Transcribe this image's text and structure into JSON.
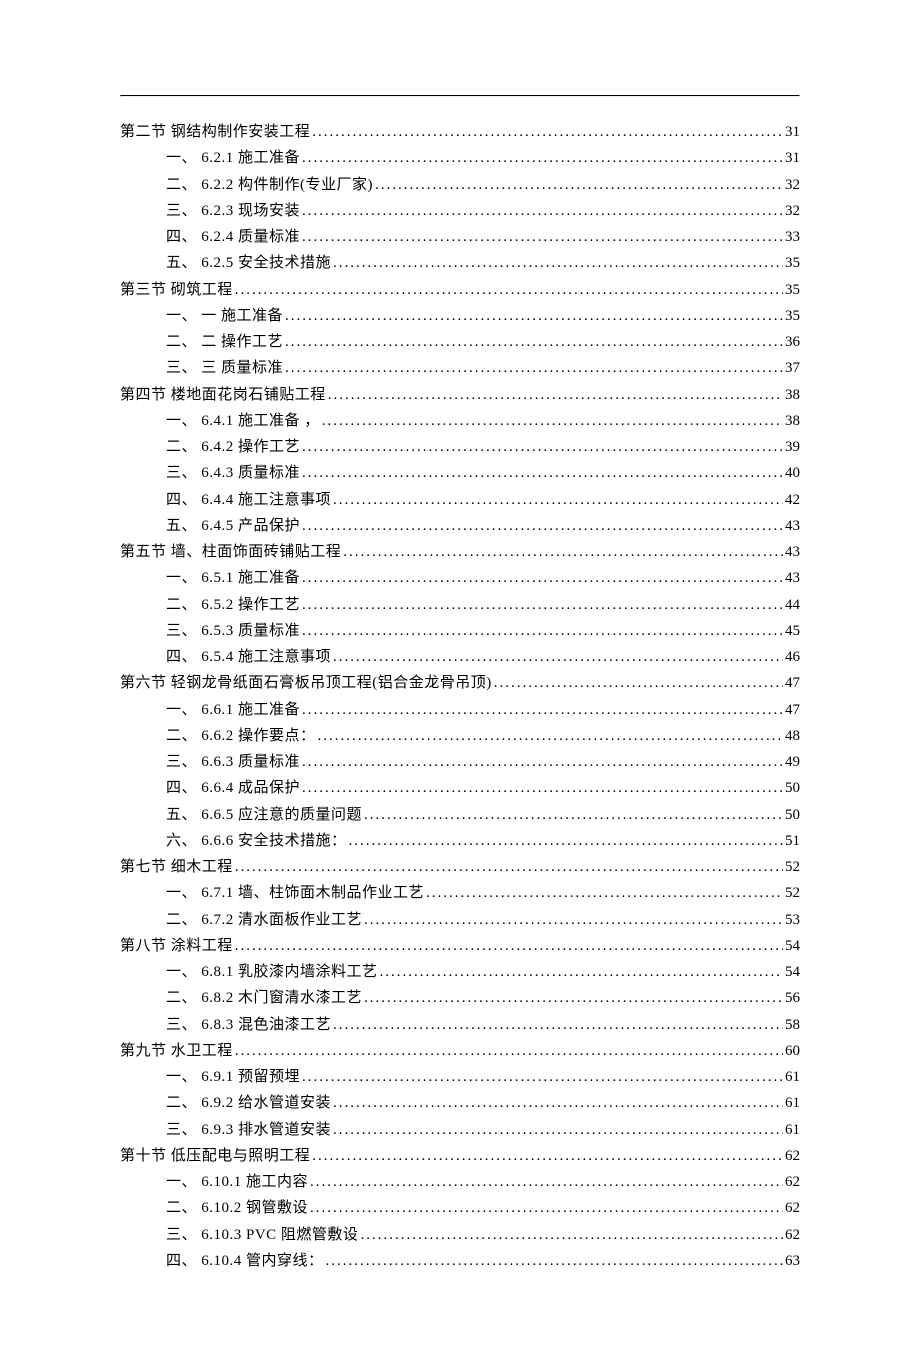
{
  "toc": [
    {
      "level": 1,
      "text": "第二节 钢结构制作安装工程",
      "page": "31"
    },
    {
      "level": 2,
      "text": "一、 6.2.1 施工准备",
      "page": "31"
    },
    {
      "level": 2,
      "text": "二、 6.2.2 构件制作(专业厂家)",
      "page": "32"
    },
    {
      "level": 2,
      "text": "三、 6.2.3  现场安装",
      "page": "32"
    },
    {
      "level": 2,
      "text": "四、 6.2.4 质量标准",
      "page": "33"
    },
    {
      "level": 2,
      "text": "五、 6.2.5  安全技术措施",
      "page": "35"
    },
    {
      "level": 1,
      "text": "第三节 砌筑工程",
      "page": "35"
    },
    {
      "level": 2,
      "text": "一、 一 施工准备",
      "page": "35"
    },
    {
      "level": 2,
      "text": "二、 二 操作工艺",
      "page": "36"
    },
    {
      "level": 2,
      "text": "三、 三 质量标准",
      "page": "37"
    },
    {
      "level": 1,
      "text": "第四节 楼地面花岗石铺贴工程",
      "page": "38"
    },
    {
      "level": 2,
      "text": "一、 6.4.1 施工准备  ，",
      "page": "38"
    },
    {
      "level": 2,
      "text": "二、 6.4.2 操作工艺",
      "page": "39"
    },
    {
      "level": 2,
      "text": "三、 6.4.3 质量标准",
      "page": "40"
    },
    {
      "level": 2,
      "text": "四、 6.4.4 施工注意事项",
      "page": "42"
    },
    {
      "level": 2,
      "text": "五、 6.4.5 产品保护",
      "page": "43"
    },
    {
      "level": 1,
      "text": "第五节 墙、柱面饰面砖铺贴工程",
      "page": "43"
    },
    {
      "level": 2,
      "text": "一、 6.5.1 施工准备",
      "page": "43"
    },
    {
      "level": 2,
      "text": "二、 6.5.2 操作工艺",
      "page": "44"
    },
    {
      "level": 2,
      "text": "三、 6.5.3 质量标准",
      "page": "45"
    },
    {
      "level": 2,
      "text": "四、 6.5.4 施工注意事项",
      "page": "46"
    },
    {
      "level": 1,
      "text": "第六节 轻钢龙骨纸面石膏板吊顶工程(铝合金龙骨吊顶)",
      "page": "47"
    },
    {
      "level": 2,
      "text": "一、 6.6.1 施工准备",
      "page": "47"
    },
    {
      "level": 2,
      "text": "二、 6.6.2 操作要点：",
      "page": "48"
    },
    {
      "level": 2,
      "text": "三、 6.6.3 质量标准",
      "page": "49"
    },
    {
      "level": 2,
      "text": "四、 6.6.4 成品保护",
      "page": "50"
    },
    {
      "level": 2,
      "text": "五、 6.6.5 应注意的质量问题",
      "page": "50"
    },
    {
      "level": 2,
      "text": "六、 6.6.6 安全技术措施：",
      "page": "51"
    },
    {
      "level": 1,
      "text": "第七节 细木工程",
      "page": "52"
    },
    {
      "level": 2,
      "text": "一、 6.7.1 墙、柱饰面木制品作业工艺",
      "page": "52"
    },
    {
      "level": 2,
      "text": "二、 6.7.2 清水面板作业工艺",
      "page": "53"
    },
    {
      "level": 1,
      "text": "第八节 涂料工程",
      "page": "54"
    },
    {
      "level": 2,
      "text": "一、 6.8.1 乳胶漆内墙涂料工艺",
      "page": "54"
    },
    {
      "level": 2,
      "text": "二、 6.8.2 木门窗清水漆工艺",
      "page": "56"
    },
    {
      "level": 2,
      "text": "三、 6.8.3  混色油漆工艺",
      "page": "58"
    },
    {
      "level": 1,
      "text": "第九节 水卫工程",
      "page": "60"
    },
    {
      "level": 2,
      "text": "一、 6.9.1 预留预埋",
      "page": "61"
    },
    {
      "level": 2,
      "text": "二、 6.9.2 给水管道安装",
      "page": "61"
    },
    {
      "level": 2,
      "text": "三、 6.9.3 排水管道安装",
      "page": "61"
    },
    {
      "level": 1,
      "text": "第十节 低压配电与照明工程",
      "page": "62"
    },
    {
      "level": 2,
      "text": "一、 6.10.1 施工内容",
      "page": "62"
    },
    {
      "level": 2,
      "text": "二、 6.10.2 钢管敷设",
      "page": "62"
    },
    {
      "level": 2,
      "text": "三、 6.10.3 PVC 阻燃管敷设",
      "page": "62"
    },
    {
      "level": 2,
      "text": "四、 6.10.4 管内穿线：",
      "page": "63"
    }
  ]
}
